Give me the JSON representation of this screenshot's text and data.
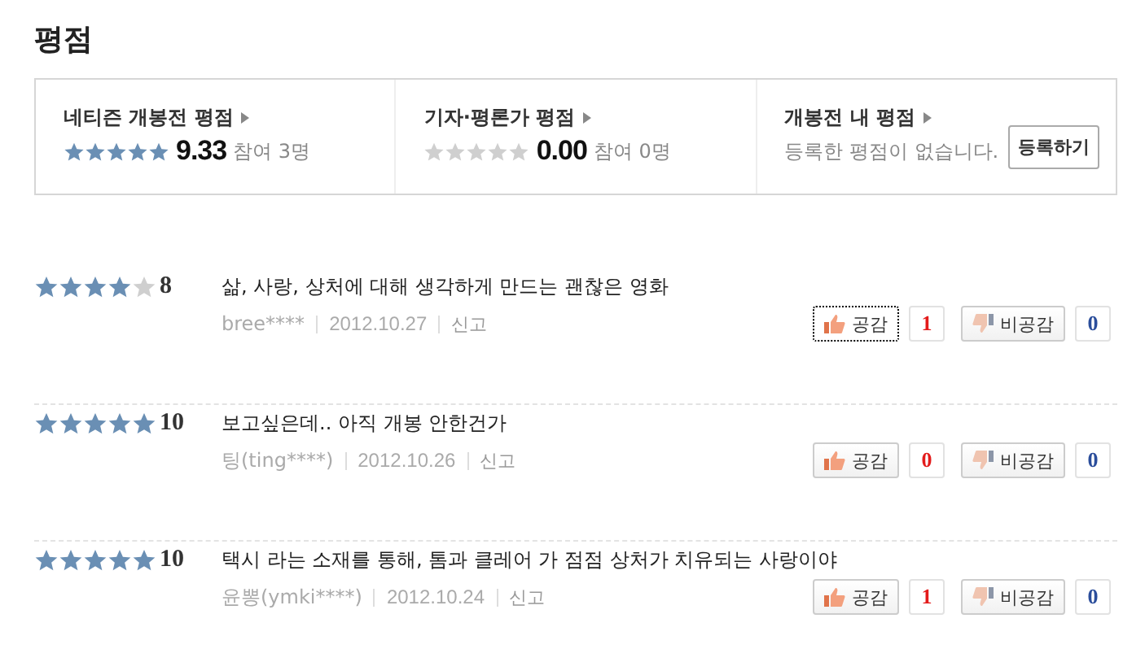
{
  "title": "평점",
  "summary": [
    {
      "kind": "score",
      "label": "네티즌 개봉전 평점",
      "stars": 5,
      "score": "9.33",
      "count": "참여 3명"
    },
    {
      "kind": "score",
      "label": "기자·평론가 평점",
      "stars": 0,
      "score": "0.00",
      "count": "참여 0명"
    },
    {
      "kind": "mine",
      "label": "개봉전 내 평점",
      "message": "등록한 평점이 없습니다.",
      "button": "등록하기"
    }
  ],
  "reviews": [
    {
      "stars": 4,
      "score": "8",
      "text": "삶, 사랑, 상처에 대해 생각하게 만드는 괜찮은 영화",
      "author": "bree****",
      "date": "2012.10.27",
      "report": "신고",
      "agree": "공감",
      "agree_count": "1",
      "agree_focused": true,
      "disagree": "비공감",
      "disagree_count": "0"
    },
    {
      "stars": 5,
      "score": "10",
      "text": "보고싶은데.. 아직 개봉 안한건가",
      "author": "팅(ting****)",
      "date": "2012.10.26",
      "report": "신고",
      "agree": "공감",
      "agree_count": "0",
      "agree_focused": false,
      "disagree": "비공감",
      "disagree_count": "0"
    },
    {
      "stars": 5,
      "score": "10",
      "text": "택시 라는 소재를 통해, 톰과 클레어 가 점점 상처가 치유되는 사랑이야",
      "author": "윤뽕(ymki****)",
      "date": "2012.10.24",
      "report": "신고",
      "agree": "공감",
      "agree_count": "1",
      "agree_focused": false,
      "disagree": "비공감",
      "disagree_count": "0"
    }
  ]
}
